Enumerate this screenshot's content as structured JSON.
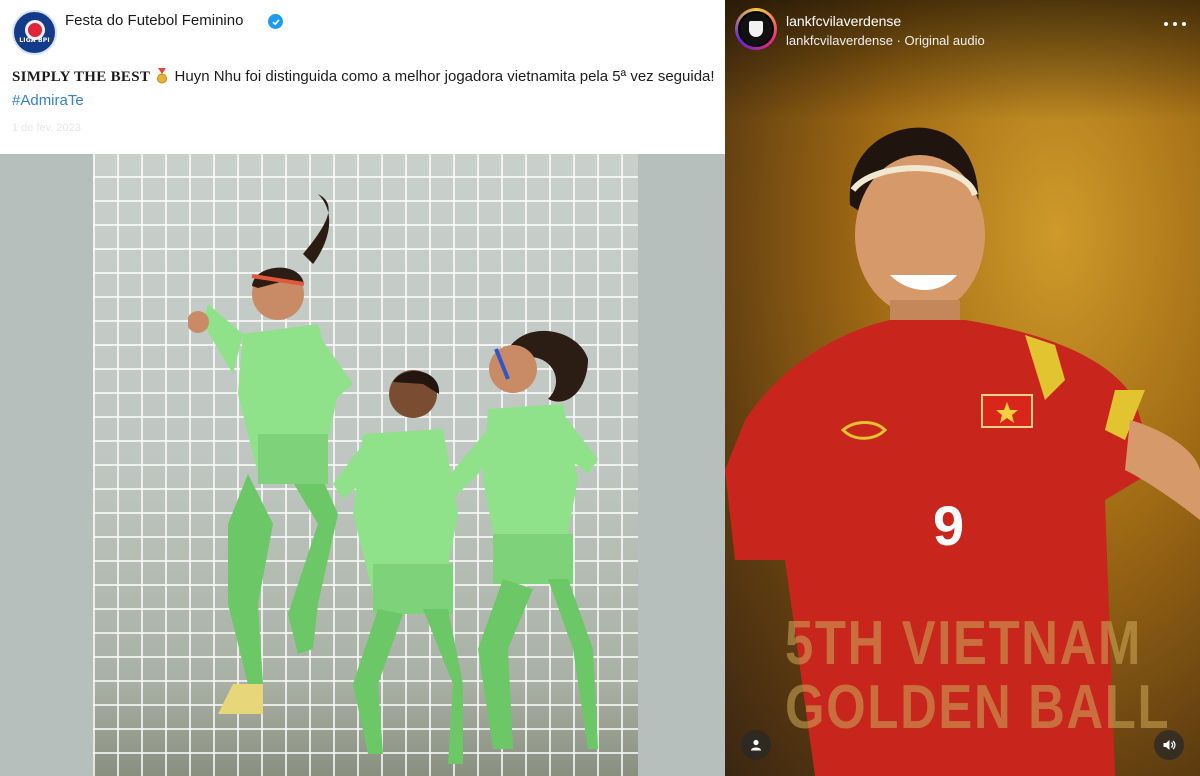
{
  "left_post": {
    "account_name": "Festa do Futebol Feminino",
    "avatar_text": "LIGA BPI",
    "caption_bold": "SIMPLY THE BEST",
    "caption_text": "Huyn Nhu foi distinguida como a melhor jogadora vietnamita pela 5ª vez seguida!",
    "hashtag": "#AdmiraTe",
    "faded_line": "1 de fev. 2023",
    "colors": {
      "hashtag": "#3a7fc1",
      "verified": "#1d9bf0",
      "kit": "#8fe28a"
    },
    "icons": [
      "verified-badge-icon",
      "medal-icon"
    ]
  },
  "right_post": {
    "username": "lankfcvilaverdense",
    "subtitle": "lankfcvilaverdense · Original audio",
    "shirt_number": "9",
    "headline_line1": "5TH VIETNAM",
    "headline_line2": "GOLDEN BALL",
    "colors": {
      "background": "#a06a14",
      "shirt": "#c8261d",
      "headline": "#cdaa5a"
    },
    "icons": [
      "more-options-icon",
      "user-tag-icon",
      "volume-icon"
    ]
  }
}
